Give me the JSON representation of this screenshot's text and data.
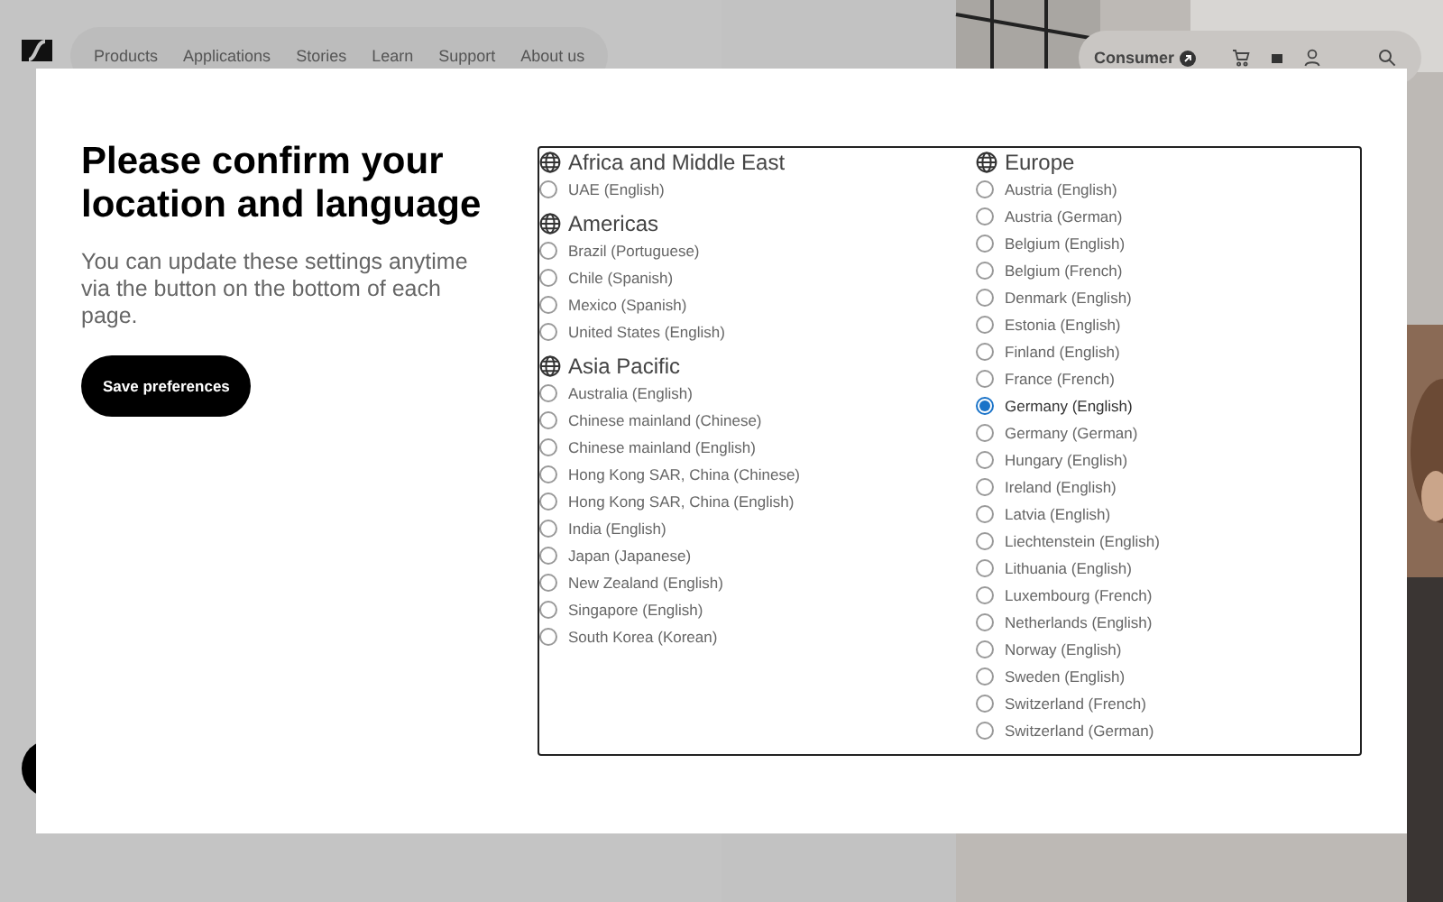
{
  "nav": {
    "links": [
      "Products",
      "Applications",
      "Stories",
      "Learn",
      "Support",
      "About us"
    ],
    "consumer": "Consumer"
  },
  "dialog": {
    "title": "Please confirm your location and language",
    "text": "You can update these settings anytime via the button on the bottom of each page.",
    "button": "Save preferences",
    "columns": [
      {
        "regions": [
          {
            "name": "Africa and Middle East",
            "options": [
              {
                "label": "UAE (English)",
                "selected": false
              }
            ]
          },
          {
            "name": "Americas",
            "options": [
              {
                "label": "Brazil (Portuguese)",
                "selected": false
              },
              {
                "label": "Chile (Spanish)",
                "selected": false
              },
              {
                "label": "Mexico (Spanish)",
                "selected": false
              },
              {
                "label": "United States (English)",
                "selected": false
              }
            ]
          },
          {
            "name": "Asia Pacific",
            "options": [
              {
                "label": "Australia (English)",
                "selected": false
              },
              {
                "label": "Chinese mainland (Chinese)",
                "selected": false
              },
              {
                "label": "Chinese mainland (English)",
                "selected": false
              },
              {
                "label": "Hong Kong SAR, China (Chinese)",
                "selected": false
              },
              {
                "label": "Hong Kong SAR, China (English)",
                "selected": false
              },
              {
                "label": "India (English)",
                "selected": false
              },
              {
                "label": "Japan (Japanese)",
                "selected": false
              },
              {
                "label": "New Zealand (English)",
                "selected": false
              },
              {
                "label": "Singapore (English)",
                "selected": false
              },
              {
                "label": "South Korea (Korean)",
                "selected": false
              }
            ]
          }
        ]
      },
      {
        "regions": [
          {
            "name": "Europe",
            "options": [
              {
                "label": "Austria (English)",
                "selected": false
              },
              {
                "label": "Austria (German)",
                "selected": false
              },
              {
                "label": "Belgium (English)",
                "selected": false
              },
              {
                "label": "Belgium (French)",
                "selected": false
              },
              {
                "label": "Denmark (English)",
                "selected": false
              },
              {
                "label": "Estonia (English)",
                "selected": false
              },
              {
                "label": "Finland (English)",
                "selected": false
              },
              {
                "label": "France (French)",
                "selected": false
              },
              {
                "label": "Germany (English)",
                "selected": true
              },
              {
                "label": "Germany (German)",
                "selected": false
              },
              {
                "label": "Hungary (English)",
                "selected": false
              },
              {
                "label": "Ireland (English)",
                "selected": false
              },
              {
                "label": "Latvia (English)",
                "selected": false
              },
              {
                "label": "Liechtenstein (English)",
                "selected": false
              },
              {
                "label": "Lithuania (English)",
                "selected": false
              },
              {
                "label": "Luxembourg (French)",
                "selected": false
              },
              {
                "label": "Netherlands (English)",
                "selected": false
              },
              {
                "label": "Norway (English)",
                "selected": false
              },
              {
                "label": "Sweden (English)",
                "selected": false
              },
              {
                "label": "Switzerland (French)",
                "selected": false
              },
              {
                "label": "Switzerland (German)",
                "selected": false
              }
            ]
          }
        ]
      }
    ]
  }
}
